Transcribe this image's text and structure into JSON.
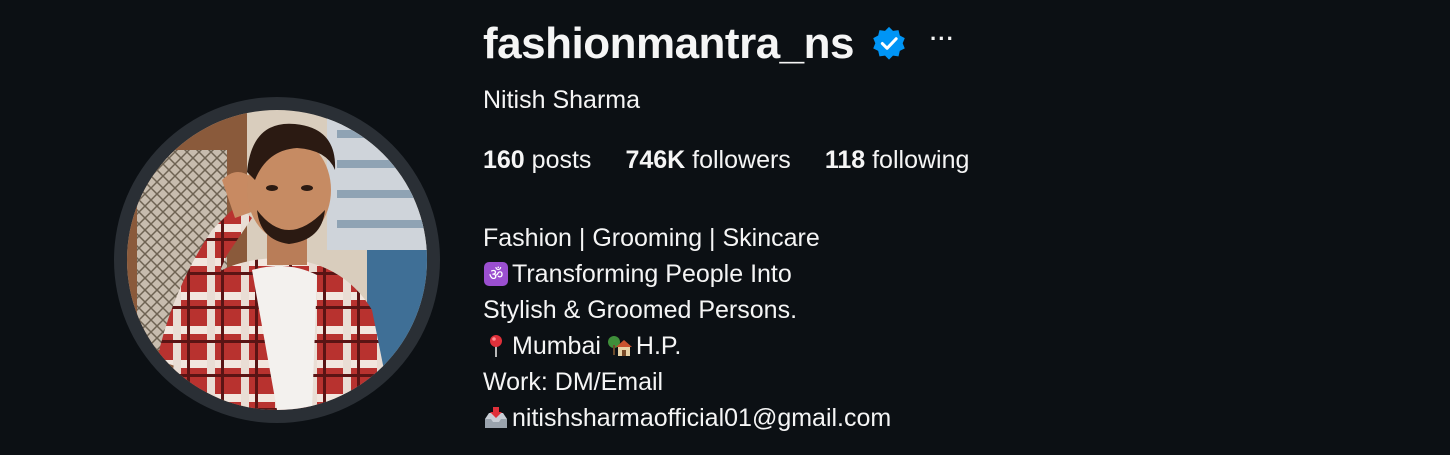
{
  "profile": {
    "username": "fashionmantra_ns",
    "full_name": "Nitish Sharma",
    "verified_icon": "verified-badge-icon",
    "more_label": "···",
    "accent_color": "#0095f6"
  },
  "stats": {
    "posts_count": "160",
    "posts_label": "posts",
    "followers_count": "746K",
    "followers_label": "followers",
    "following_count": "118",
    "following_label": "following"
  },
  "bio": {
    "line1": "Fashion | Grooming | Skincare",
    "line2": "Transforming People Into",
    "line3": "Stylish & Groomed Persons.",
    "line4_a": "Mumbai",
    "line4_b": "H.P.",
    "line5": "Work: DM/Email",
    "line6": "nitishsharmaofficial01@gmail.com",
    "icons": [
      "om-icon",
      "pin-icon",
      "house-icon",
      "inbox-tray-icon"
    ]
  }
}
